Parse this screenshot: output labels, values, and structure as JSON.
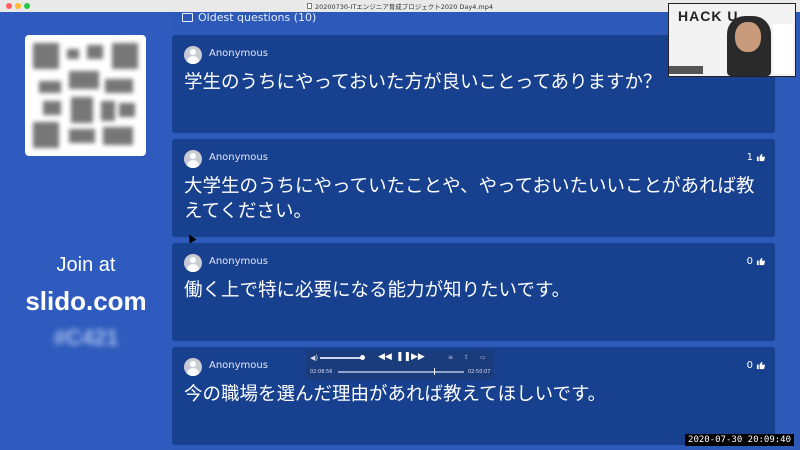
{
  "window": {
    "title": "20200730-ITエンジニア育成プロジェクト2020 Day4.mp4"
  },
  "left_panel": {
    "join_label": "Join at",
    "site": "slido.com",
    "event_code": "#C421"
  },
  "questions_header": {
    "label": "Oldest questions (10)"
  },
  "questions": [
    {
      "author": "Anonymous",
      "text": "学生のうちにやっておいた方が良いことってありますか？",
      "likes": ""
    },
    {
      "author": "Anonymous",
      "text": "大学生のうちにやっていたことや、やっておいたいいことがあれば教えてください。",
      "likes": "1"
    },
    {
      "author": "Anonymous",
      "text": "働く上で特に必要になる能力が知りたいです。",
      "likes": "0"
    },
    {
      "author": "Anonymous",
      "text": "今の職場を選んだ理由があれば教えてほしいです。",
      "likes": "0"
    }
  ],
  "player": {
    "elapsed": "02:08:56",
    "duration": "02:50:07",
    "progress": 0.76
  },
  "webcam": {
    "logo": "HACK U"
  },
  "timestamp": "2020-07-30  20:09:40",
  "colors": {
    "background": "#2d5ab8",
    "card": "#17408f",
    "text": "#ffffff"
  },
  "icons": [
    "chat-icon",
    "avatar-icon",
    "thumbs-up-icon",
    "volume-icon",
    "rewind-icon",
    "pause-icon",
    "fast-forward-icon"
  ]
}
